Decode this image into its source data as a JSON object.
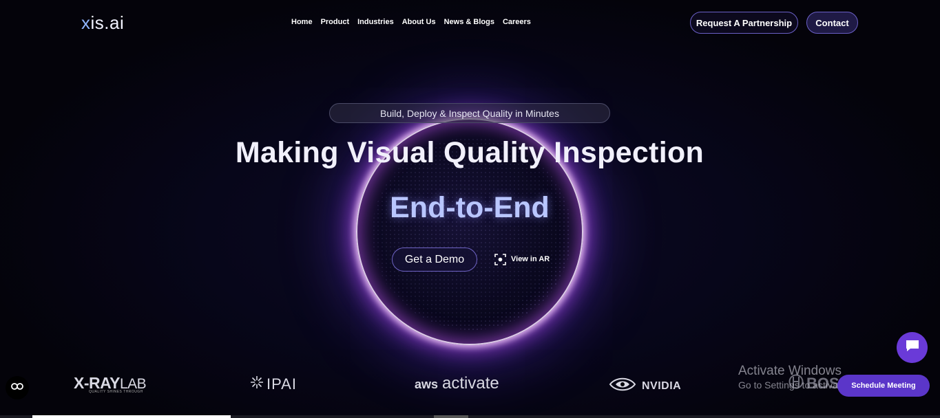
{
  "header": {
    "logo": {
      "x": "x",
      "rest": "is.ai"
    },
    "nav": [
      "Home",
      "Product",
      "Industries",
      "About Us",
      "News & Blogs",
      "Careers"
    ],
    "partnership_label": "Request A Partnership",
    "contact_label": "Contact"
  },
  "hero": {
    "pill": "Build, Deploy & Inspect Quality in Minutes",
    "title": "Making Visual Quality Inspection",
    "subtitle": "End-to-End",
    "demo_label": "Get a Demo",
    "ar_label": "View in AR",
    "ar_icon": "ar-scan-icon"
  },
  "partners": {
    "xray": {
      "main": "X-RAY",
      "lab": "LAB",
      "tagline": "QUALITY SHINES THROUGH"
    },
    "ipai": "IPAI",
    "aws": {
      "aw": "aws",
      "activate": "activate"
    },
    "nvidia": "NVIDIA",
    "bosch": "BOSCH"
  },
  "watermark": {
    "line1": "Activate Windows",
    "line2": "Go to Settings to activate Windows."
  },
  "widgets": {
    "schedule_label": "Schedule Meeting",
    "chat_icon": "chat-icon",
    "accessibility_icon": "accessibility-icon"
  },
  "colors": {
    "accent": "#5b36c9",
    "subtitle": "#b9c6ff",
    "background": "#05040c"
  }
}
